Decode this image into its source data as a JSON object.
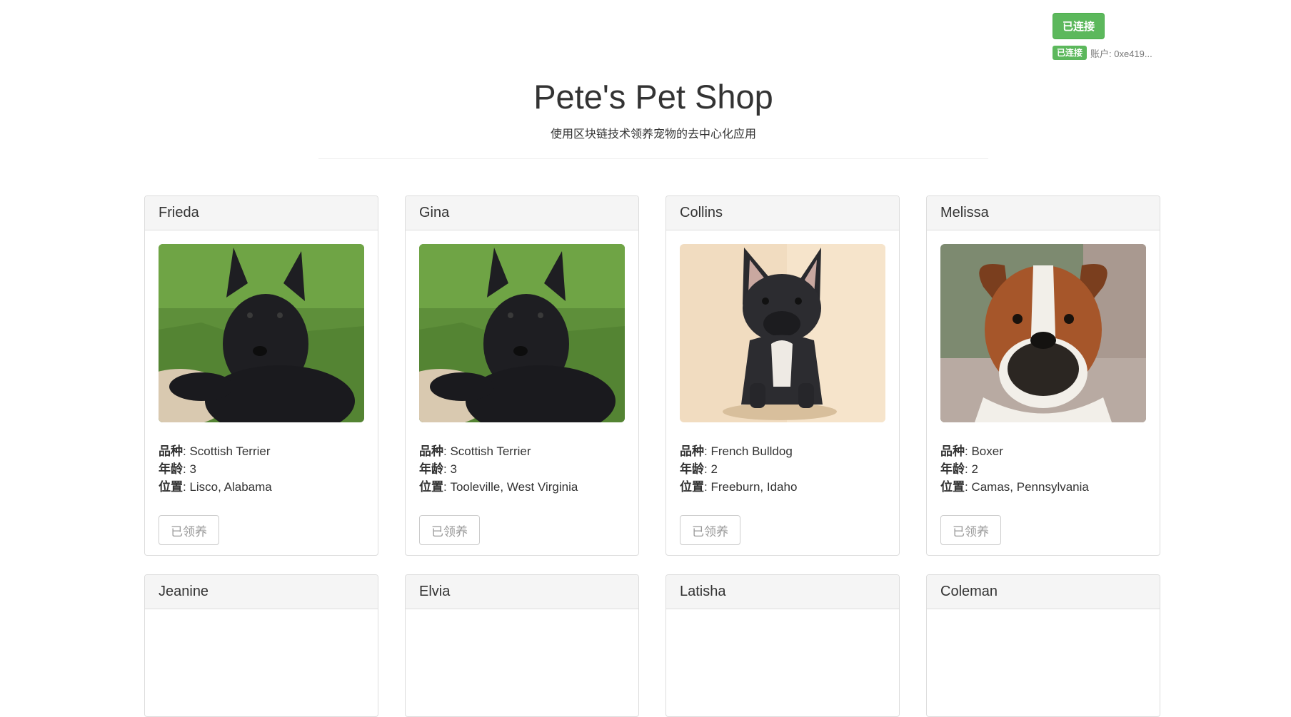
{
  "header": {
    "connect_button_label": "已连接",
    "status_badge": "已连接",
    "account_label": "账户: 0xe419...",
    "title": "Pete's Pet Shop",
    "subtitle": "使用区块链技术领养宠物的去中心化应用"
  },
  "labels": {
    "breed": "品种",
    "age": "年龄",
    "location": "位置",
    "colon": ": "
  },
  "pets": [
    {
      "name": "Frieda",
      "breed": "Scottish Terrier",
      "age": "3",
      "location": "Lisco, Alabama",
      "button": "已领养",
      "photo": "scottish-terrier-photo"
    },
    {
      "name": "Gina",
      "breed": "Scottish Terrier",
      "age": "3",
      "location": "Tooleville, West Virginia",
      "button": "已领养",
      "photo": "scottish-terrier-photo"
    },
    {
      "name": "Collins",
      "breed": "French Bulldog",
      "age": "2",
      "location": "Freeburn, Idaho",
      "button": "已领养",
      "photo": "french-bulldog-photo"
    },
    {
      "name": "Melissa",
      "breed": "Boxer",
      "age": "2",
      "location": "Camas, Pennsylvania",
      "button": "已领养",
      "photo": "boxer-photo"
    }
  ],
  "next_row_pets": [
    {
      "name": "Jeanine"
    },
    {
      "name": "Elvia"
    },
    {
      "name": "Latisha"
    },
    {
      "name": "Coleman"
    }
  ],
  "colors": {
    "success": "#5cb85c",
    "panel_heading_bg": "#f5f5f5",
    "border": "#dddddd",
    "disabled_text": "#999999"
  }
}
